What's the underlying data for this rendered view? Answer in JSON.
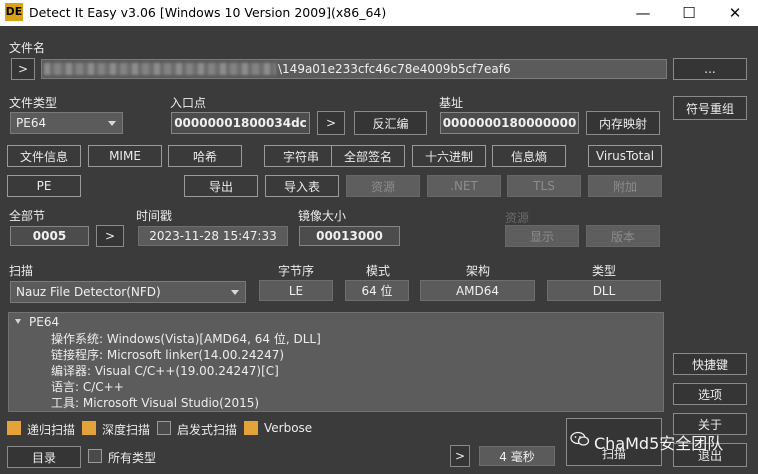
{
  "window": {
    "title": "Detect It Easy v3.06 [Windows 10 Version 2009](x86_64)",
    "icon_text": "DE",
    "controls": {
      "minimize": "—",
      "maximize": "☐",
      "close": "✕"
    }
  },
  "file": {
    "label": "文件名",
    "browse_arrow": ">",
    "path_visible_suffix": "\\149a01e233cfc46c78e4009b5cf7eaf6",
    "browse_button": "..."
  },
  "filetype": {
    "label": "文件类型",
    "value": "PE64"
  },
  "entry_point": {
    "label": "入口点",
    "value": "00000001800034dc",
    "go_button": ">",
    "disasm_button": "反汇编"
  },
  "base_address": {
    "label": "基址",
    "value": "0000000180000000",
    "memmap_button": "内存映射"
  },
  "right_buttons": {
    "symbols": "符号重组",
    "shortcuts": "快捷键",
    "options": "选项",
    "about": "关于",
    "exit": "退出"
  },
  "row_buttons1": [
    "文件信息",
    "MIME",
    "哈希",
    "字符串",
    "全部签名",
    "十六进制",
    "信息熵",
    "VirusTotal"
  ],
  "row_buttons2": {
    "pe": "PE",
    "export": "导出",
    "import": "导入表",
    "resources": "资源",
    "dotnet": ".NET",
    "tls": "TLS",
    "overlay": "附加"
  },
  "sections": {
    "label": "全部节",
    "value": "0005",
    "go_button": ">"
  },
  "timestamp": {
    "label": "时间戳",
    "value": "2023-11-28 15:47:33"
  },
  "image_size": {
    "label": "镜像大小",
    "value": "00013000"
  },
  "resources_panel": {
    "label": "资源",
    "show_button": "显示",
    "version_button": "版本"
  },
  "scan": {
    "label": "扫描",
    "engine": "Nauz File Detector(NFD)",
    "endianness_label": "字节序",
    "endianness": "LE",
    "mode_label": "模式",
    "mode": "64 位",
    "arch_label": "架构",
    "arch": "AMD64",
    "type_label": "类型",
    "type": "DLL"
  },
  "results": {
    "root": "PE64",
    "lines": [
      "操作系统: Windows(Vista)[AMD64, 64 位, DLL]",
      "链接程序: Microsoft linker(14.00.24247)",
      "编译器: Visual C/C++(19.00.24247)[C]",
      "语言: C/C++",
      "工具: Microsoft Visual Studio(2015)"
    ]
  },
  "options": {
    "recursive": {
      "label": "递归扫描",
      "checked": true
    },
    "deep": {
      "label": "深度扫描",
      "checked": true
    },
    "heuristic": {
      "label": "启发式扫描",
      "checked": false
    },
    "verbose": {
      "label": "Verbose",
      "checked": true
    }
  },
  "bottom": {
    "directory_button": "目录",
    "all_types_label": "所有类型",
    "next_button": ">",
    "time_value": "4 毫秒",
    "scan_button": "扫描"
  },
  "watermark": "ChaMd5安全团队",
  "colors": {
    "background": "#3b3b3b",
    "check_on": "#e3a33a",
    "field": "#5b5b5b",
    "icon": "#d8a218"
  }
}
